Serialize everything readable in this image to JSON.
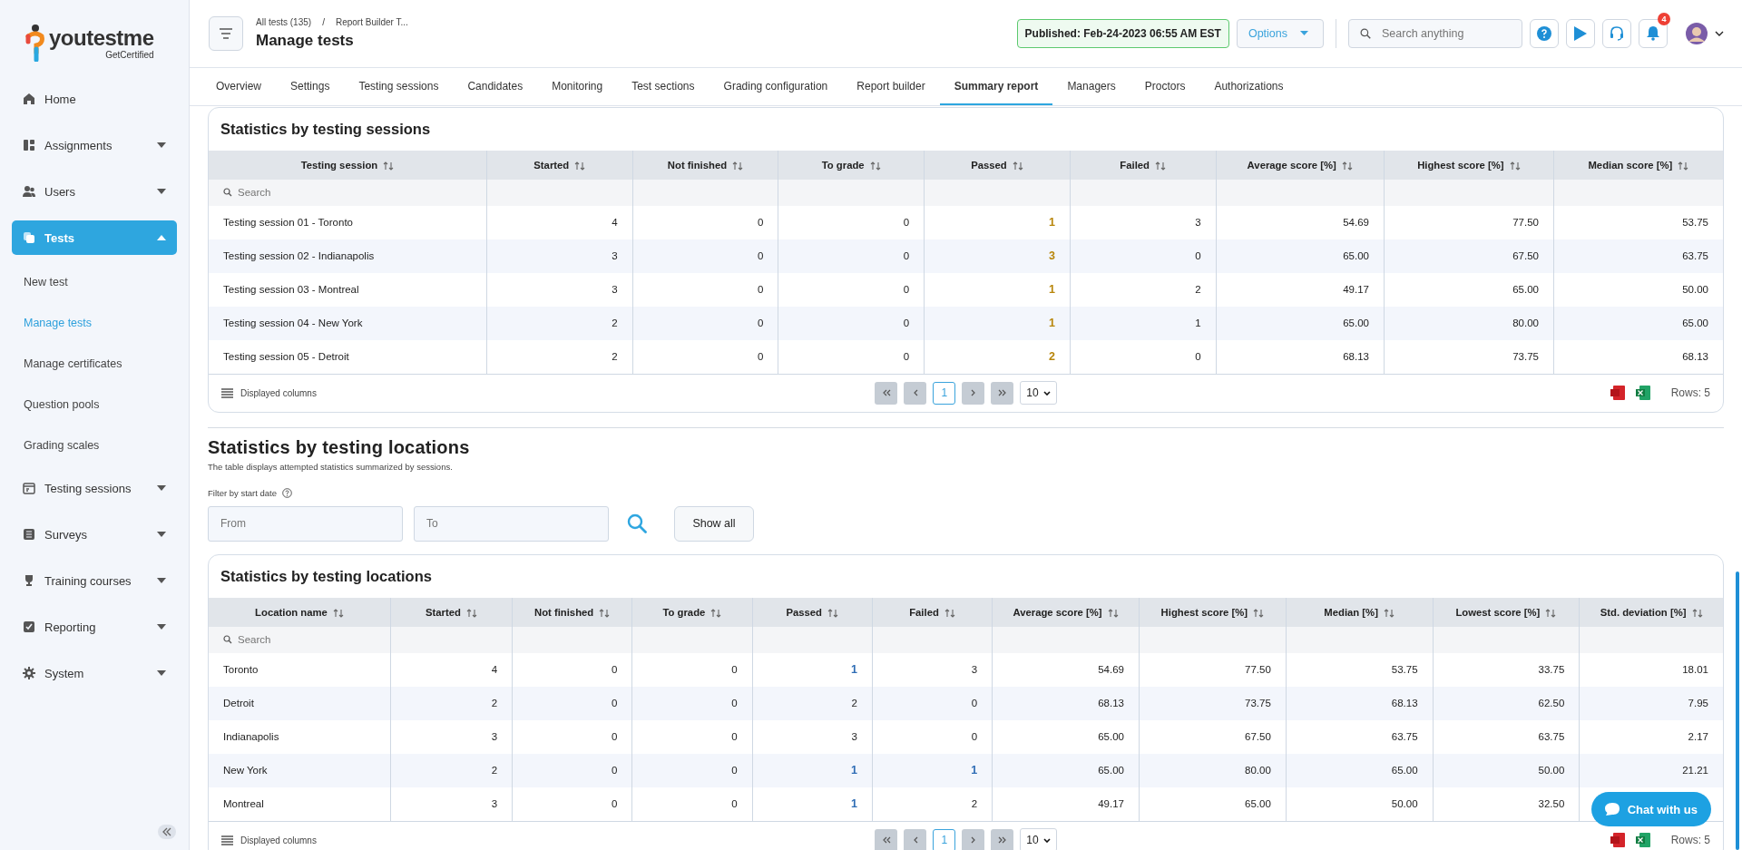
{
  "logo": {
    "text": "youtestme",
    "tagline": "GetCertified"
  },
  "nav": [
    {
      "label": "Home",
      "selected": false
    },
    {
      "label": "Assignments",
      "selected": false,
      "expanded": false
    },
    {
      "label": "Users",
      "selected": false,
      "expanded": false
    },
    {
      "label": "Tests",
      "selected": true,
      "expanded": true,
      "children": [
        {
          "label": "New test",
          "selected": false
        },
        {
          "label": "Manage tests",
          "selected": true
        },
        {
          "label": "Manage certificates",
          "selected": false
        },
        {
          "label": "Question pools",
          "selected": false
        },
        {
          "label": "Grading scales",
          "selected": false
        }
      ]
    },
    {
      "label": "Testing sessions",
      "selected": false,
      "expanded": false
    },
    {
      "label": "Surveys",
      "selected": false,
      "expanded": false
    },
    {
      "label": "Training courses",
      "selected": false,
      "expanded": false
    },
    {
      "label": "Reporting",
      "selected": false,
      "expanded": false
    },
    {
      "label": "System",
      "selected": false,
      "expanded": false
    }
  ],
  "header": {
    "breadcrumb": [
      "All tests (135)",
      "Report Builder T..."
    ],
    "breadcrumb_separator": "/",
    "title": "Manage tests",
    "published": "Published: Feb-24-2023 06:55 AM EST",
    "options": "Options",
    "search_placeholder": "Search anything",
    "notifications": "4"
  },
  "tabs": [
    {
      "label": "Overview",
      "selected": false
    },
    {
      "label": "Settings",
      "selected": false
    },
    {
      "label": "Testing sessions",
      "selected": false
    },
    {
      "label": "Candidates",
      "selected": false
    },
    {
      "label": "Monitoring",
      "selected": false
    },
    {
      "label": "Test sections",
      "selected": false
    },
    {
      "label": "Grading configuration",
      "selected": false
    },
    {
      "label": "Report builder",
      "selected": false
    },
    {
      "label": "Summary report",
      "selected": true
    },
    {
      "label": "Managers",
      "selected": false
    },
    {
      "label": "Proctors",
      "selected": false
    },
    {
      "label": "Authorizations",
      "selected": false
    }
  ],
  "location_section": {
    "title": "Statistics by testing locations",
    "description": "The table displays attempted statistics summarized by sessions.",
    "filter_label": "Filter by start date",
    "from_placeholder": "From",
    "to_placeholder": "To",
    "show_all": "Show all"
  },
  "tables": [
    {
      "title": "Statistics by testing sessions",
      "columns": [
        "Testing session",
        "Started",
        "Not finished",
        "To grade",
        "Passed",
        "Failed",
        "Average score [%]",
        "Highest score [%]",
        "Median score [%]"
      ],
      "search_placeholder": "Search",
      "rows": [
        {
          "cells": [
            "Testing session 01 - Toronto",
            "4",
            "0",
            "0",
            {
              "text": "1",
              "color": "#b8860b"
            },
            "3",
            "54.69",
            "77.50",
            "53.75"
          ]
        },
        {
          "cells": [
            "Testing session 02 - Indianapolis",
            "3",
            "0",
            "0",
            {
              "text": "3",
              "color": "#b8860b"
            },
            "0",
            "65.00",
            "67.50",
            "63.75"
          ]
        },
        {
          "cells": [
            "Testing session 03 - Montreal",
            "3",
            "0",
            "0",
            {
              "text": "1",
              "color": "#b8860b"
            },
            "2",
            "49.17",
            "65.00",
            "50.00"
          ]
        },
        {
          "cells": [
            "Testing session 04 - New York",
            "2",
            "0",
            "0",
            {
              "text": "1",
              "color": "#b8860b"
            },
            "1",
            "65.00",
            "80.00",
            "65.00"
          ]
        },
        {
          "cells": [
            "Testing session 05 - Detroit",
            "2",
            "0",
            "0",
            {
              "text": "2",
              "color": "#b8860b"
            },
            "0",
            "68.13",
            "73.75",
            "68.13"
          ]
        }
      ],
      "displayed_columns": "Displayed columns",
      "page": "1",
      "page_size": "10",
      "rows_count": "Rows: 5"
    },
    {
      "title": "Statistics by testing locations",
      "columns": [
        "Location name",
        "Started",
        "Not finished",
        "To grade",
        "Passed",
        "Failed",
        "Average score [%]",
        "Highest score [%]",
        "Median [%]",
        "Lowest score [%]",
        "Std. deviation [%]"
      ],
      "search_placeholder": "Search",
      "rows": [
        {
          "cells": [
            "Toronto",
            "4",
            "0",
            "0",
            {
              "text": "1",
              "color": "#2f6db5"
            },
            "3",
            "54.69",
            "77.50",
            "53.75",
            "33.75",
            "18.01"
          ]
        },
        {
          "cells": [
            "Detroit",
            "2",
            "0",
            "0",
            "2",
            "0",
            "68.13",
            "73.75",
            "68.13",
            "62.50",
            "7.95"
          ]
        },
        {
          "cells": [
            "Indianapolis",
            "3",
            "0",
            "0",
            "3",
            "0",
            "65.00",
            "67.50",
            "63.75",
            "63.75",
            "2.17"
          ]
        },
        {
          "cells": [
            "New York",
            "2",
            "0",
            "0",
            {
              "text": "1",
              "color": "#2f6db5"
            },
            {
              "text": "1",
              "color": "#2f6db5"
            },
            "65.00",
            "80.00",
            "65.00",
            "50.00",
            "21.21"
          ]
        },
        {
          "cells": [
            "Montreal",
            "3",
            "0",
            "0",
            {
              "text": "1",
              "color": "#2f6db5"
            },
            "2",
            "49.17",
            "65.00",
            "50.00",
            "32.50",
            null
          ]
        }
      ],
      "displayed_columns": "Displayed columns",
      "page": "1",
      "page_size": "10",
      "rows_count": "Rows: 5"
    }
  ],
  "chat": "Chat with us"
}
